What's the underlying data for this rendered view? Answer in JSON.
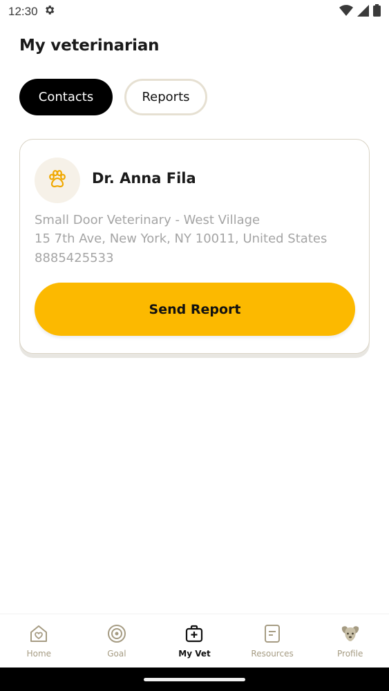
{
  "status_bar": {
    "time": "12:30",
    "icons": [
      "gear-icon",
      "wifi-icon",
      "signal-icon",
      "battery-icon"
    ]
  },
  "page": {
    "title": "My veterinarian"
  },
  "tabs": [
    {
      "label": "Contacts",
      "active": true
    },
    {
      "label": "Reports",
      "active": false
    }
  ],
  "vet_card": {
    "avatar_icon": "paw-icon",
    "name": "Dr. Anna Fila",
    "clinic": "Small Door Veterinary - West Village",
    "address": "15 7th Ave, New York, NY 10011, United States",
    "phone": "8885425533",
    "action_label": "Send Report"
  },
  "bottom_nav": {
    "items": [
      {
        "label": "Home",
        "icon": "home-heart-icon",
        "active": false
      },
      {
        "label": "Goal",
        "icon": "target-icon",
        "active": false
      },
      {
        "label": "My Vet",
        "icon": "medical-bag-icon",
        "active": true
      },
      {
        "label": "Resources",
        "icon": "document-icon",
        "active": false
      },
      {
        "label": "Profile",
        "icon": "dog-face-icon",
        "active": false
      }
    ]
  },
  "colors": {
    "accent": "#FCB900",
    "active_tab": "#000000",
    "muted_text": "#A4A4A4",
    "nav_inactive": "#A59B82"
  }
}
